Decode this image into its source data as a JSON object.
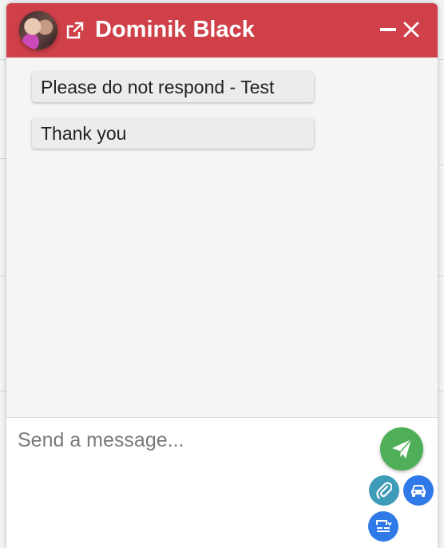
{
  "header": {
    "contact_name": "Dominik Black",
    "background_color": "#cf4049",
    "avatar_icon": "contact-avatar",
    "popout_icon": "external-link-icon",
    "minimize_icon": "minimize-icon",
    "close_icon": "close-icon"
  },
  "messages": [
    {
      "text": "Please do not respond - Test"
    },
    {
      "text": "Thank you"
    }
  ],
  "composer": {
    "placeholder": "Send a message...",
    "value": "",
    "send_icon": "paper-plane-icon",
    "send_color": "#4fae58",
    "attach_icon": "paperclip-icon",
    "attach_color": "#3f9cb8",
    "vehicle_icon": "car-icon",
    "vehicle_color": "#2f79e8",
    "template_icon": "template-list-icon",
    "template_color": "#2f79e8"
  }
}
